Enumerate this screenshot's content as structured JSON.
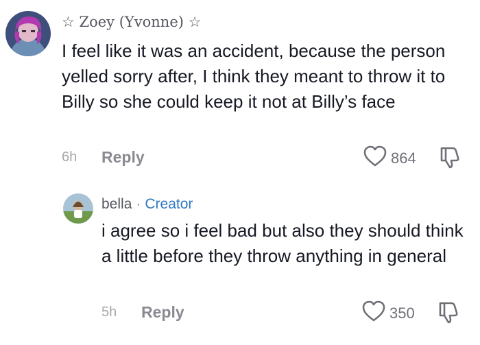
{
  "comments": [
    {
      "username": "☆ Zoey (Yvonne) ☆",
      "body": "I feel like it was an accident, because the person yelled sorry after, I think they meant to throw it to Billy so she could keep it not at Billy’s face",
      "time": "6h",
      "reply_label": "Reply",
      "likes": "864"
    },
    {
      "username": "bella",
      "separator": "·",
      "creator_label": "Creator",
      "body": "i agree so i feel bad but also they should think a little before they throw anything in general",
      "time": "5h",
      "reply_label": "Reply",
      "likes": "350"
    }
  ],
  "icons": {
    "like": "heart-outline-icon",
    "dislike": "thumbs-down-icon"
  },
  "colors": {
    "creator": "#2f78c4",
    "text": "#161823",
    "muted": "#8a8b91"
  }
}
